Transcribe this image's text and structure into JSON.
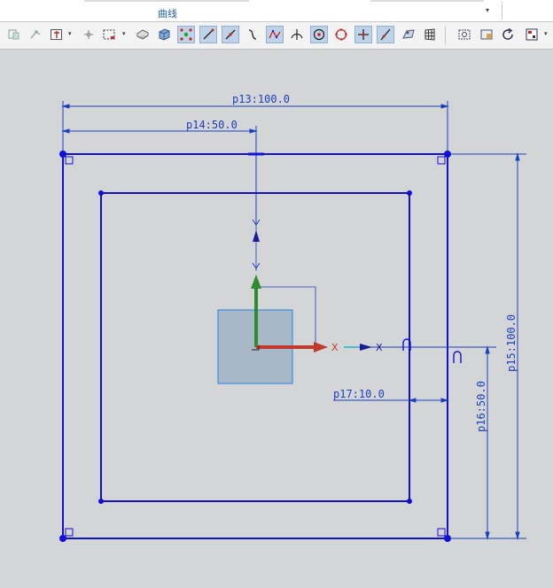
{
  "ribbon": {
    "group_label": "曲线",
    "dropdown_glyph": "▾"
  },
  "toolbar": {
    "icons": [
      "snap-icon",
      "snap-curve-icon",
      "select-filter-icon",
      "move-object-icon",
      "box-select-icon",
      "solid-view-icon",
      "shaded-box-icon",
      "snap-point-icon",
      "line-icon",
      "line-through-icon",
      "arc-icon",
      "spline-icon",
      "perpendicular-icon",
      "circle-center-icon",
      "circle-icon",
      "add-point-icon",
      "diagonal-icon",
      "view-orient-icon",
      "grid-icon",
      "view-capture-icon",
      "image-window-icon",
      "refresh-icon",
      "display-mode-icon"
    ]
  },
  "sketch": {
    "dimensions": {
      "p13": "p13:100.0",
      "p14": "p14:50.0",
      "p15": "p15:100.0",
      "p16": "p16:50.0",
      "p17": "p17:10.0"
    },
    "axis": {
      "x_label": "X",
      "x_label_outer": "X"
    },
    "colors": {
      "sketch": "#1010d8",
      "dimension": "#1a3fbf",
      "x_axis": "#c0392b",
      "y_axis": "#2e8b2e",
      "block": "#a9b8c8"
    }
  }
}
